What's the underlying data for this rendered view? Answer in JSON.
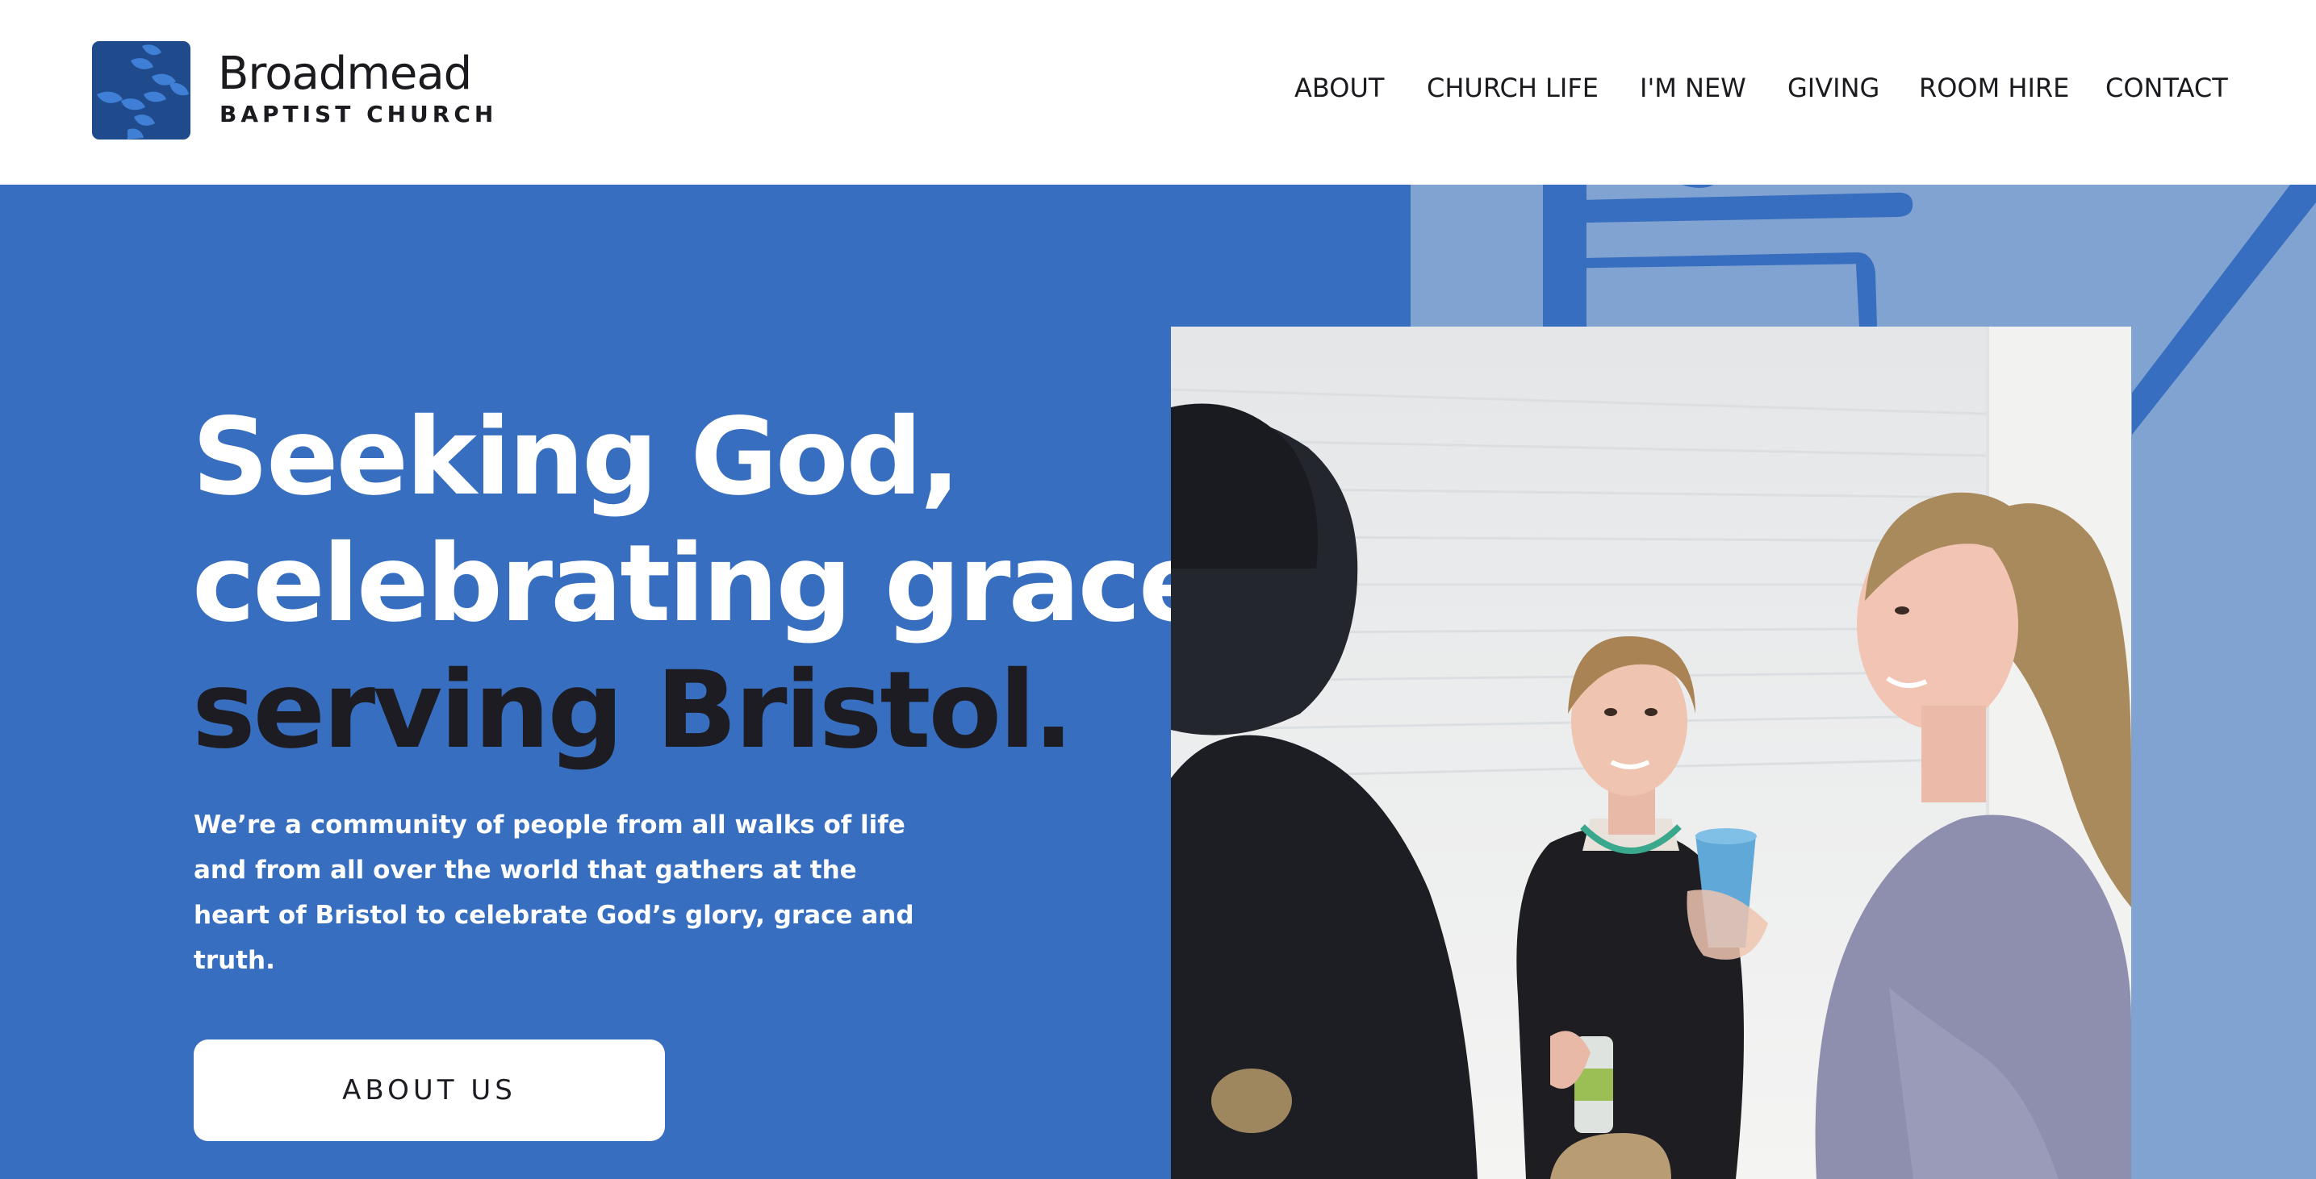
{
  "colors": {
    "hero_blue": "#376ebf",
    "hero_light_blue": "#80a3d1",
    "logo_navy": "#1f4a8c",
    "text_dark": "#1c1c22",
    "white": "#ffffff"
  },
  "header": {
    "logo": {
      "icon": "rope-knot-icon",
      "name": "Broadmead",
      "subtitle": "BAPTIST CHURCH"
    },
    "nav": [
      {
        "label": "ABOUT"
      },
      {
        "label": "CHURCH LIFE"
      },
      {
        "label": "I'M NEW"
      },
      {
        "label": "GIVING"
      },
      {
        "label": "ROOM HIRE"
      },
      {
        "label": "CONTACT"
      }
    ]
  },
  "hero": {
    "headline": {
      "line1": "Seeking God,",
      "line2": "celebrating grace,",
      "line3": "serving Bristol."
    },
    "intro": "We’re a community of people from all walks of life and from all over the world that gathers at the heart of Bristol to celebrate God’s glory, grace and truth.",
    "cta_label": "ABOUT US",
    "photo": "photo of three women talking and smiling at a church gathering"
  }
}
